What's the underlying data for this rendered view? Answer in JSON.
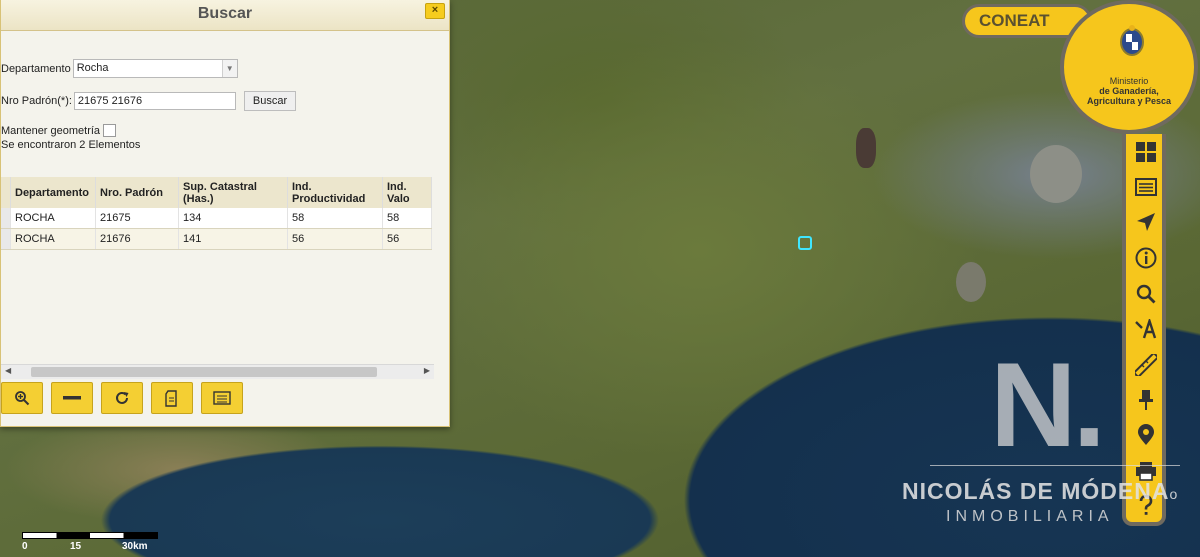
{
  "panel": {
    "title": "Buscar",
    "close_icon": "×",
    "departamento_label": "Departamento",
    "departamento_value": "Rocha",
    "padron_label": "Nro Padrón(*):",
    "padron_value": "21675 21676",
    "buscar_button": "Buscar",
    "mantener_label": "Mantener geometría",
    "result_text": "Se encontraron 2 Elementos",
    "table": {
      "headers": [
        "Departamento",
        "Nro. Padrón",
        "Sup. Catastral (Has.)",
        "Ind. Productividad",
        "Ind. Valo"
      ],
      "rows": [
        [
          "ROCHA",
          "21675",
          "134",
          "58",
          "58"
        ],
        [
          "ROCHA",
          "21676",
          "141",
          "56",
          "56"
        ]
      ]
    },
    "toolbar_icons": [
      "zoom-in-icon",
      "minus-icon",
      "refresh-icon",
      "document-icon",
      "list-icon"
    ]
  },
  "app": {
    "tab_label": "CONEAT",
    "ministry_line1": "Ministerio",
    "ministry_line2": "de Ganadería,",
    "ministry_line3": "Agricultura y Pesca",
    "side_icons": [
      "grid-icon",
      "layers-list-icon",
      "navigate-icon",
      "info-icon",
      "search-icon",
      "text-search-icon",
      "ruler-icon",
      "pin-icon",
      "location-icon",
      "print-icon",
      "help-icon"
    ]
  },
  "watermark": {
    "initial": "N.",
    "name": "NICOLÁS DE MÓDENA",
    "mark": "o",
    "subtitle": "INMOBILIARIA"
  },
  "scale": {
    "labels": [
      "0",
      "15",
      "30km"
    ]
  },
  "colors": {
    "accent": "#f6c61c",
    "border": "#6f6a5f"
  }
}
